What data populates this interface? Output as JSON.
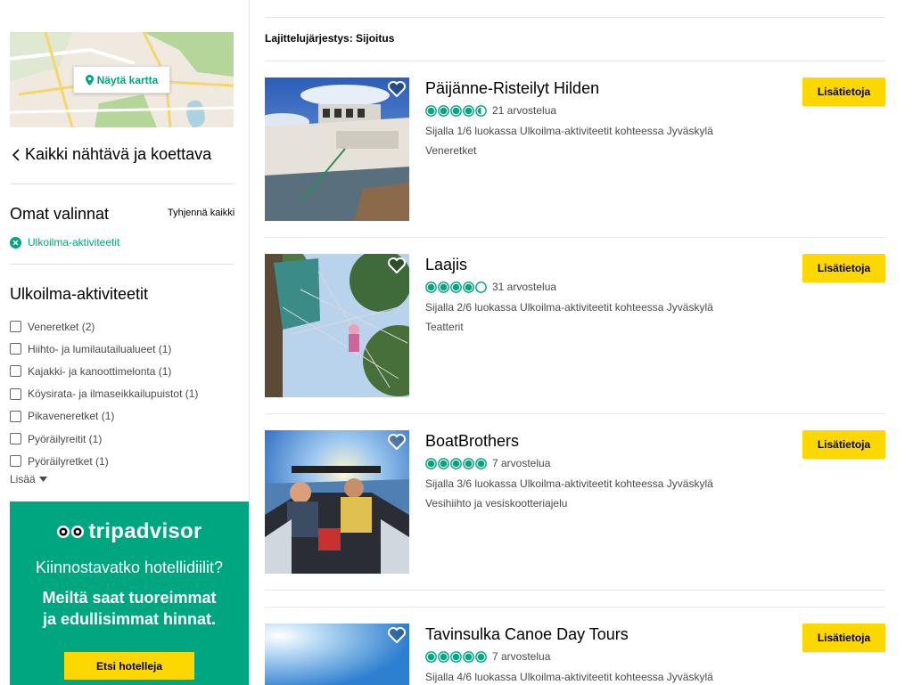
{
  "sidebar": {
    "map_button": "Näytä kartta",
    "back_link": "Kaikki nähtävä ja koettava",
    "own_choices_title": "Omat valinnat",
    "clear_all": "Tyhjennä kaikki",
    "active_filter": "Ulkoilma-aktiviteetit",
    "category_title": "Ulkoilma-aktiviteetit",
    "filters": [
      "Veneretket (2)",
      "Hiihto- ja lumilautailualueet (1)",
      "Kajakki- ja kanoottimelonta (1)",
      "Köysirata- ja ilmaseikkailupuistot (1)",
      "Pikaveneretket (1)",
      "Pyöräilyreitit (1)",
      "Pyöräilyretket (1)"
    ],
    "more": "Lisää"
  },
  "ad": {
    "logo": "tripadvisor",
    "question": "Kiinnostavatko hotellidiilit?",
    "line1": "Meiltä saat tuoreimmat",
    "line2": "ja edullisimmat hinnat.",
    "button": "Etsi hotelleja"
  },
  "sort_label": "Lajittelujärjestys: Sijoitus",
  "listings": [
    {
      "title": "Päijänne-Risteilyt Hilden",
      "rating": 4.5,
      "reviews": "21 arvostelua",
      "rank": "Sijalla 1/6 luokassa Ulkoilma-aktiviteetit kohteessa Jyväskylä",
      "category": "Veneretket",
      "button": "Lisätietoja"
    },
    {
      "title": "Laajis",
      "rating": 4.0,
      "reviews": "31 arvostelua",
      "rank": "Sijalla 2/6 luokassa Ulkoilma-aktiviteetit kohteessa Jyväskylä",
      "category": "Teatterit",
      "button": "Lisätietoja"
    },
    {
      "title": "BoatBrothers",
      "rating": 5.0,
      "reviews": "7 arvostelua",
      "rank": "Sijalla 3/6 luokassa Ulkoilma-aktiviteetit kohteessa Jyväskylä",
      "category": "Vesihiihto ja vesiskootteriajelu",
      "button": "Lisätietoja"
    },
    {
      "title": "Tavinsulka Canoe Day Tours",
      "rating": 5.0,
      "reviews": "7 arvostelua",
      "rank": "Sijalla 4/6 luokassa Ulkoilma-aktiviteetit kohteessa Jyväskylä",
      "category": "",
      "button": "Lisätietoja"
    }
  ],
  "colors": {
    "brand_green": "#00a680",
    "button_yellow": "#fcd700"
  }
}
